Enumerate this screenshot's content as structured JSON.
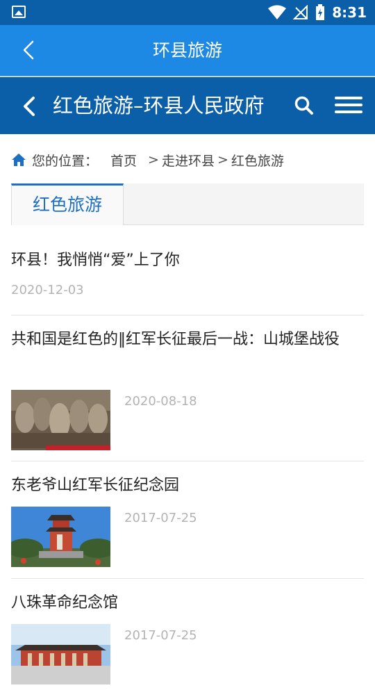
{
  "status_bar": {
    "time": "8:31"
  },
  "app_bar": {
    "title": "环县旅游"
  },
  "site_header": {
    "title": "红色旅游–环县人民政府"
  },
  "breadcrumb": {
    "prefix": "您的位置：",
    "items": [
      "首页",
      "走进环县",
      "红色旅游"
    ],
    "separator": ">"
  },
  "tabs": [
    {
      "label": "红色旅游",
      "active": true
    }
  ],
  "articles": [
    {
      "title": "环县！我悄悄“爱”上了你",
      "date": "2020-12-03",
      "has_thumb": false
    },
    {
      "title": "共和国是红色的‖红军长征最后一战：山城堡战役",
      "date": "2020-08-18",
      "has_thumb": true,
      "thumb": "stone-relief-sculpture"
    },
    {
      "title": "东老爷山红军长征纪念园",
      "date": "2017-07-25",
      "has_thumb": true,
      "thumb": "pagoda-monument"
    },
    {
      "title": "八珠革命纪念馆",
      "date": "2017-07-25",
      "has_thumb": true,
      "thumb": "memorial-hall"
    }
  ],
  "colors": {
    "status_bar": "#0b5ea8",
    "app_bar": "#1e88e5",
    "site_header": "#0b5ea8",
    "accent": "#1e6fc2"
  }
}
